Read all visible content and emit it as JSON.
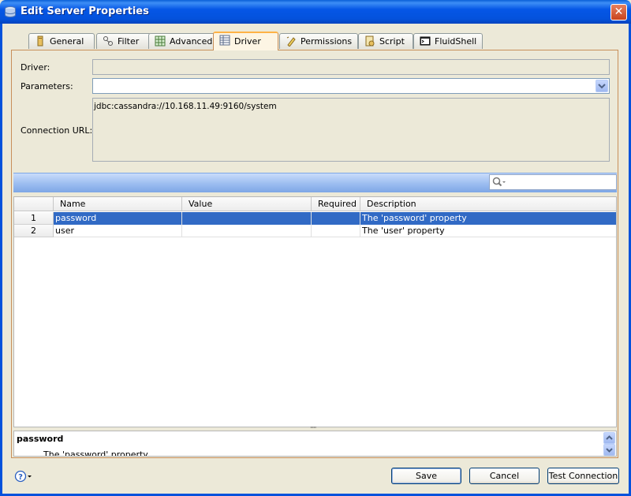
{
  "window": {
    "title": "Edit Server Properties",
    "close_glyph": "✕"
  },
  "tabs": [
    {
      "label": "General",
      "icon": "general-icon",
      "active": false
    },
    {
      "label": "Filter",
      "icon": "filter-icon",
      "active": false
    },
    {
      "label": "Advanced",
      "icon": "advanced-icon",
      "active": false
    },
    {
      "label": "Driver",
      "icon": "driver-icon",
      "active": true
    },
    {
      "label": "Permissions",
      "icon": "permissions-icon",
      "active": false
    },
    {
      "label": "Script",
      "icon": "script-icon",
      "active": false
    },
    {
      "label": "FluidShell",
      "icon": "fluidshell-icon",
      "active": false
    }
  ],
  "form": {
    "driver_label": "Driver:",
    "driver_value": "",
    "parameters_label": "Parameters:",
    "parameters_value": "",
    "connection_url_label": "Connection URL:",
    "connection_url_value": "jdbc:cassandra://10.168.11.49:9160/system"
  },
  "search": {
    "placeholder": ""
  },
  "table": {
    "columns": [
      "Name",
      "Value",
      "Required",
      "Description"
    ],
    "rows": [
      {
        "num": "1",
        "name": "password",
        "value": "",
        "required": "",
        "description": "The 'password' property",
        "selected": true
      },
      {
        "num": "2",
        "name": "user",
        "value": "",
        "required": "",
        "description": "The 'user' property",
        "selected": false
      }
    ]
  },
  "splitter": {
    "grip": "····"
  },
  "detail": {
    "title": "password",
    "description": "The 'password' property"
  },
  "buttons": {
    "save": "Save",
    "cancel": "Cancel",
    "test_connection": "Test Connection",
    "help_glyph": "?"
  },
  "colors": {
    "titlebar": "#0452dc",
    "selection": "#316ac5",
    "active_tab_accent": "#ffb245",
    "window_bg": "#ece9d8"
  }
}
